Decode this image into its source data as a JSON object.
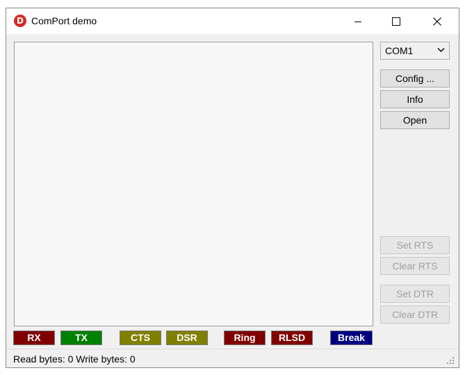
{
  "window": {
    "title": "ComPort demo",
    "app_icon": "delphi-logo-icon",
    "controls": {
      "minimize": "minimize-icon",
      "maximize": "maximize-icon",
      "close": "close-icon"
    }
  },
  "port_select": {
    "value": "COM1",
    "icon": "chevron-down-icon"
  },
  "buttons": {
    "config": "Config ...",
    "info": "Info",
    "open": "Open",
    "set_rts": "Set RTS",
    "clear_rts": "Clear RTS",
    "set_dtr": "Set DTR",
    "clear_dtr": "Clear DTR"
  },
  "leds": [
    {
      "label": "RX",
      "color": "#800000"
    },
    {
      "label": "TX",
      "color": "#008000"
    },
    {
      "label": "CTS",
      "color": "#808000"
    },
    {
      "label": "DSR",
      "color": "#808000"
    },
    {
      "label": "Ring",
      "color": "#800000"
    },
    {
      "label": "RLSD",
      "color": "#800000"
    },
    {
      "label": "Break",
      "color": "#000080"
    }
  ],
  "status": {
    "text": "Read bytes: 0  Write bytes: 0",
    "grip_icon": "resize-grip-icon"
  }
}
